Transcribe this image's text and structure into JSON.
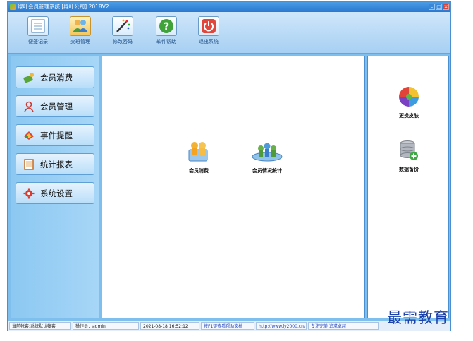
{
  "window": {
    "title": "绿叶会员管理系统 [绿叶公司] 2018V2"
  },
  "toolbar": [
    {
      "label": "便签记录",
      "icon": "notepad-icon"
    },
    {
      "label": "交班管理",
      "icon": "users-group-icon",
      "active": true
    },
    {
      "label": "修改密码",
      "icon": "wand-icon"
    },
    {
      "label": "软件帮助",
      "icon": "help-icon"
    },
    {
      "label": "退出系统",
      "icon": "power-icon"
    }
  ],
  "sidebar": {
    "items": [
      {
        "label": "会员消费",
        "icon": "cash-icon"
      },
      {
        "label": "会员管理",
        "icon": "user-icon"
      },
      {
        "label": "事件提醒",
        "icon": "reminder-icon"
      },
      {
        "label": "统计报表",
        "icon": "report-icon"
      },
      {
        "label": "系统设置",
        "icon": "gear-icon"
      }
    ]
  },
  "main": {
    "shortcuts": [
      {
        "label": "会员消费",
        "icon": "member-consume-icon"
      },
      {
        "label": "会员情况统计",
        "icon": "member-stats-icon"
      }
    ]
  },
  "right": {
    "shortcuts": [
      {
        "label": "更换皮肤",
        "icon": "color-wheel-icon"
      },
      {
        "label": "数据备份",
        "icon": "database-backup-icon"
      }
    ]
  },
  "status": {
    "account": "当前帐套:系统默认帐套",
    "operator": "操作员：admin",
    "datetime": "2021-08-18 16:52:12",
    "help": "按F1键查看帮助文档",
    "url": "http://www.ly2000.cn/",
    "slogan": "专注完美 追求卓越"
  },
  "watermark": "最需教育",
  "colors": {
    "title_bar": "#2a78cf",
    "panel": "#8cc8f2",
    "accent": "#4a8fd0"
  }
}
